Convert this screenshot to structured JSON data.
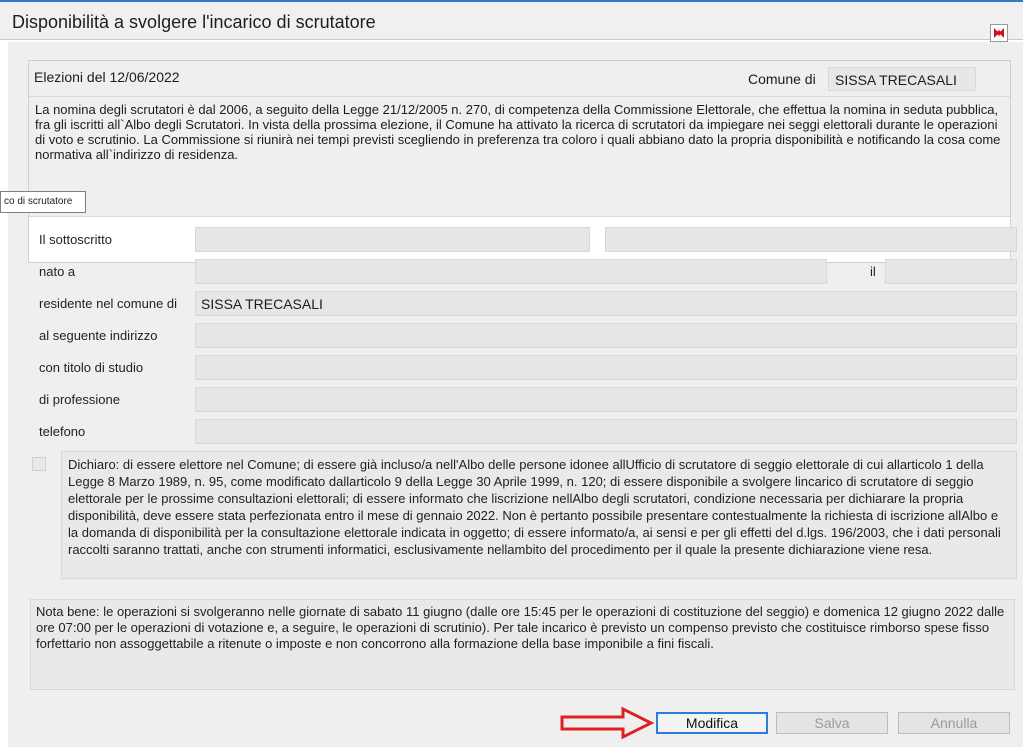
{
  "window": {
    "title": "Disponibilità a svolgere l'incarico di scrutatore"
  },
  "header": {
    "election": "Elezioni del 12/06/2022",
    "comune_label": "Comune di",
    "comune_value": "SISSA TRECASALI"
  },
  "intro_text": "La nomina degli scrutatori è dal 2006, a seguito della Legge 21/12/2005 n. 270, di competenza della Commissione Elettorale, che effettua la nomina in seduta pubblica, fra gli iscritti all`Albo degli Scrutatori. In vista della prossima elezione, il Comune ha attivato la ricerca di scrutatori da impiegare nei seggi elettorali durante le operazioni di voto e scrutinio. La Commissione si riunirà nei tempi previsti scegliendo in preferenza tra coloro i quali abbiano dato la propria disponibilità e notificando la cosa come normativa all`indirizzo di residenza.",
  "tooltip": "co di scrutatore",
  "form": {
    "sottoscritto_label": "Il sottoscritto",
    "nato_label": "nato a",
    "il_label": "il",
    "residente_label": "residente nel comune di",
    "residente_value": "SISSA TRECASALI",
    "indirizzo_label": "al seguente indirizzo",
    "titolo_label": "con titolo di studio",
    "professione_label": "di professione",
    "telefono_label": "telefono"
  },
  "declaration": {
    "checked": false,
    "text": "Dichiaro: di essere elettore nel Comune; di essere già incluso/a nell'Albo delle persone idonee allUfficio di scrutatore di seggio elettorale di cui allarticolo 1 della Legge 8 Marzo 1989, n. 95, come modificato dallarticolo 9 della Legge 30 Aprile 1999, n. 120; di essere disponibile a svolgere lincarico di scrutatore di seggio elettorale per le prossime consultazioni elettorali; di essere informato che liscrizione nellAlbo degli scrutatori, condizione necessaria per dichiarare la propria disponibilità, deve essere stata perfezionata entro il mese di gennaio 2022. Non è pertanto possibile presentare contestualmente la richiesta di iscrizione allAlbo e la domanda di disponibilità per la consultazione elettorale indicata in oggetto; di essere informato/a, ai sensi e per gli effetti del d.lgs. 196/2003, che i dati personali raccolti saranno trattati, anche con strumenti informatici, esclusivamente nellambito del procedimento per il quale la presente dichiarazione viene resa."
  },
  "nota_text": "Nota bene: le operazioni si svolgeranno nelle giornate di sabato 11 giugno (dalle ore 15:45 per le operazioni di costituzione del seggio) e domenica 12 giugno 2022 dalle ore 07:00 per le operazioni di votazione  e, a seguire, le operazioni di scrutinio). Per tale incarico è previsto un compenso previsto che costituisce rimborso spese fisso forfettario non assoggettabile a ritenute o imposte e non concorrono alla formazione della base imponibile a fini fiscali.",
  "buttons": {
    "modifica": "Modifica",
    "salva": "Salva",
    "annulla": "Annulla"
  },
  "colors": {
    "accent_blue": "#2f7bd8",
    "arrow_red": "#e02020",
    "close_red": "#d0141b"
  },
  "icons": {
    "close": "close-icon",
    "arrow": "red-arrow-icon"
  }
}
